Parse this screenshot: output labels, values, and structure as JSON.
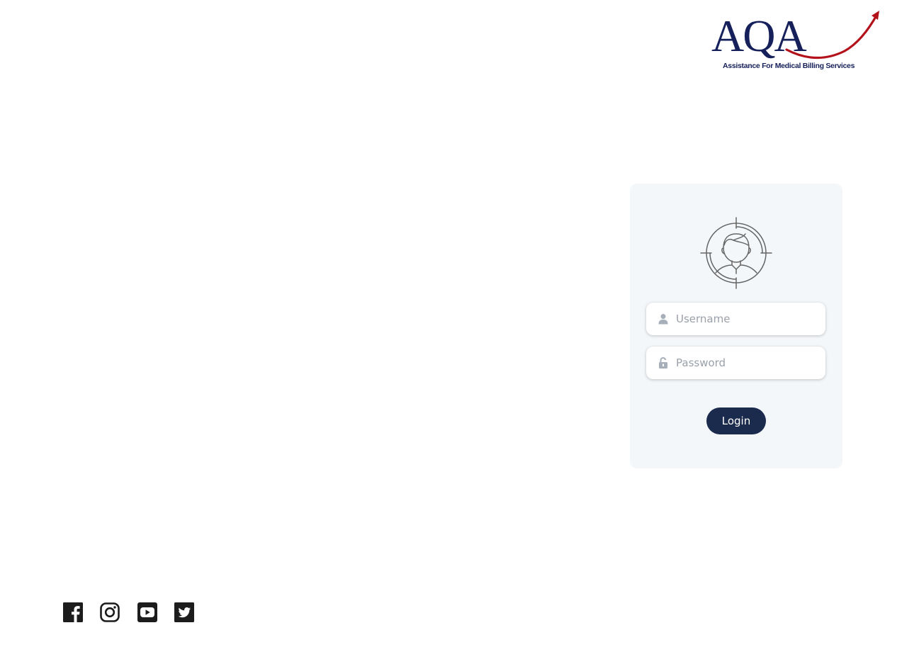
{
  "brand": {
    "logo_text": "AQA",
    "tagline": "Assistance For Medical Billing Services",
    "primary_color": "#16205a",
    "accent_color": "#b3121b"
  },
  "login": {
    "username_placeholder": "Username",
    "username_value": "",
    "password_placeholder": "Password",
    "password_value": "",
    "button_label": "Login",
    "button_color": "#1b2b4d",
    "card_background": "#f4f7fa"
  },
  "social": {
    "items": [
      {
        "name": "facebook",
        "icon": "facebook-icon"
      },
      {
        "name": "instagram",
        "icon": "instagram-icon"
      },
      {
        "name": "youtube",
        "icon": "youtube-icon"
      },
      {
        "name": "twitter",
        "icon": "twitter-icon"
      }
    ]
  }
}
